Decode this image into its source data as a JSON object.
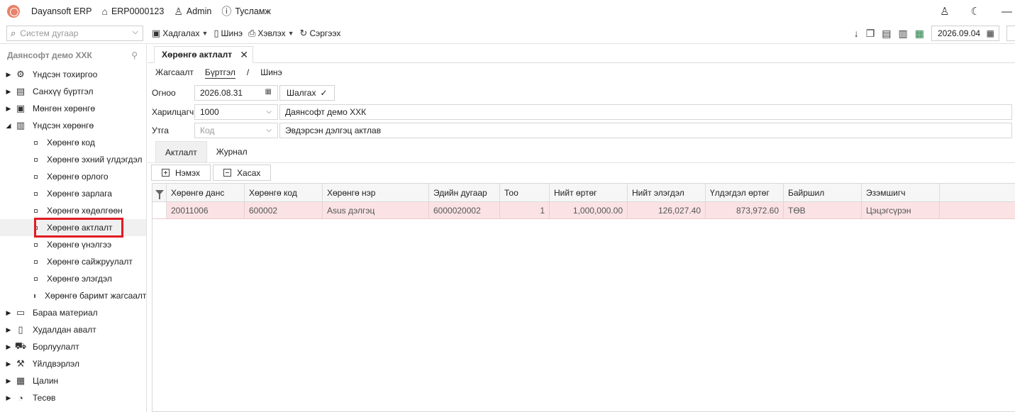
{
  "titlebar": {
    "app_name": "Dayansoft ERP",
    "db_name": "ERP0000123",
    "user": "Admin",
    "help": "Тусламж"
  },
  "toolbar": {
    "search_placeholder": "Систем дугаар",
    "save": "Хадгалах",
    "new": "Шинэ",
    "print": "Хэвлэх",
    "refresh": "Сэргээх",
    "date": "2026.09.04"
  },
  "sidebar": {
    "company": "Даянсофт демо ХХК",
    "items_top": [
      {
        "label": "Үндсэн тохиргоо",
        "icon": "gear-icon",
        "glyph": "⚙"
      },
      {
        "label": "Санхүү бүртгэл",
        "icon": "ledger-icon",
        "glyph": "▤"
      },
      {
        "label": "Мөнгөн хөрөнгө",
        "icon": "cash-icon",
        "glyph": "▣"
      },
      {
        "label": "Үндсэн хөрөнгө",
        "icon": "building-icon",
        "glyph": "▥"
      }
    ],
    "children": [
      "Хөрөнгө код",
      "Хөрөнгө эхний үлдэгдэл",
      "Хөрөнгө орлого",
      "Хөрөнгө зарлага",
      "Хөрөнгө хөдөлгөөн",
      "Хөрөнгө актлалт",
      "Хөрөнгө үнэлгээ",
      "Хөрөнгө сайжруулалт",
      "Хөрөнгө элэгдэл",
      "Хөрөнгө баримт жагсаалт"
    ],
    "items_bottom": [
      {
        "label": "Бараа материал",
        "icon": "box-icon",
        "glyph": "▭"
      },
      {
        "label": "Худалдан авалт",
        "icon": "wallet-icon",
        "glyph": "▯"
      },
      {
        "label": "Борлуулалт",
        "icon": "cart-icon",
        "glyph": "⛟"
      },
      {
        "label": "Үйлдвэрлэл",
        "icon": "factory-icon",
        "glyph": "⚒"
      },
      {
        "label": "Цалин",
        "icon": "calculator-icon",
        "glyph": "▦"
      },
      {
        "label": "Тесөв",
        "icon": "pie-chart-icon",
        "glyph": "◔"
      }
    ]
  },
  "main": {
    "tab_title": "Хөрөнгө актлалт",
    "breadcrumb": [
      "Жагсаалт",
      "Бүртгэл",
      "/",
      "Шинэ"
    ],
    "form": {
      "date_label": "Огноо",
      "date_value": "2026.08.31",
      "check_button": "Шалгах",
      "partner_label": "Харилцагч",
      "partner_code": "1000",
      "partner_name": "Даянсофт демо ХХК",
      "reason_label": "Утга",
      "reason_placeholder": "Код",
      "reason_text": "Эвдэрсэн дэлгэц актлав"
    },
    "sub_tabs": [
      "Актлалт",
      "Журнал"
    ],
    "add_button": "Нэмэх",
    "remove_button": "Хасах"
  },
  "grid": {
    "columns": [
      "Хөрөнгө данс",
      "Хөрөнгө код",
      "Хөрөнгө нэр",
      "Эдийн дугаар",
      "Тоо",
      "Нийт өртөг",
      "Нийт элэгдэл",
      "Үлдэгдэл өртөг",
      "Байршил",
      "Эзэмшигч"
    ],
    "rows": [
      [
        "20011006",
        "600002",
        "Asus дэлгэц",
        "6000020002",
        "1",
        "1,000,000.00",
        "126,027.40",
        "873,972.60",
        "ТӨВ",
        "Цэцэгсүрэн"
      ]
    ]
  },
  "colors": {
    "selected_row": "#fbe3e5",
    "highlight": "#e01b24",
    "logo": "#e8826a"
  }
}
